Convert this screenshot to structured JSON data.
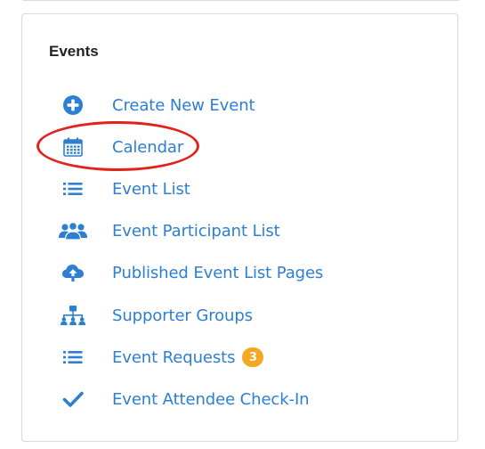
{
  "panel": {
    "title": "Events",
    "items": [
      {
        "label": "Create New Event",
        "icon": "plus-circle-icon"
      },
      {
        "label": "Calendar",
        "icon": "calendar-icon"
      },
      {
        "label": "Event List",
        "icon": "list-icon"
      },
      {
        "label": "Event Participant List",
        "icon": "users-icon"
      },
      {
        "label": "Published Event List Pages",
        "icon": "cloud-upload-icon"
      },
      {
        "label": "Supporter Groups",
        "icon": "sitemap-icon"
      },
      {
        "label": "Event Requests",
        "icon": "list-icon",
        "badge": "3"
      },
      {
        "label": "Event Attendee Check-In",
        "icon": "checkmark-icon"
      }
    ]
  },
  "colors": {
    "link": "#2c7fd1",
    "badge": "#f5a623",
    "highlight": "#e3231b",
    "border": "#d6d9de"
  }
}
